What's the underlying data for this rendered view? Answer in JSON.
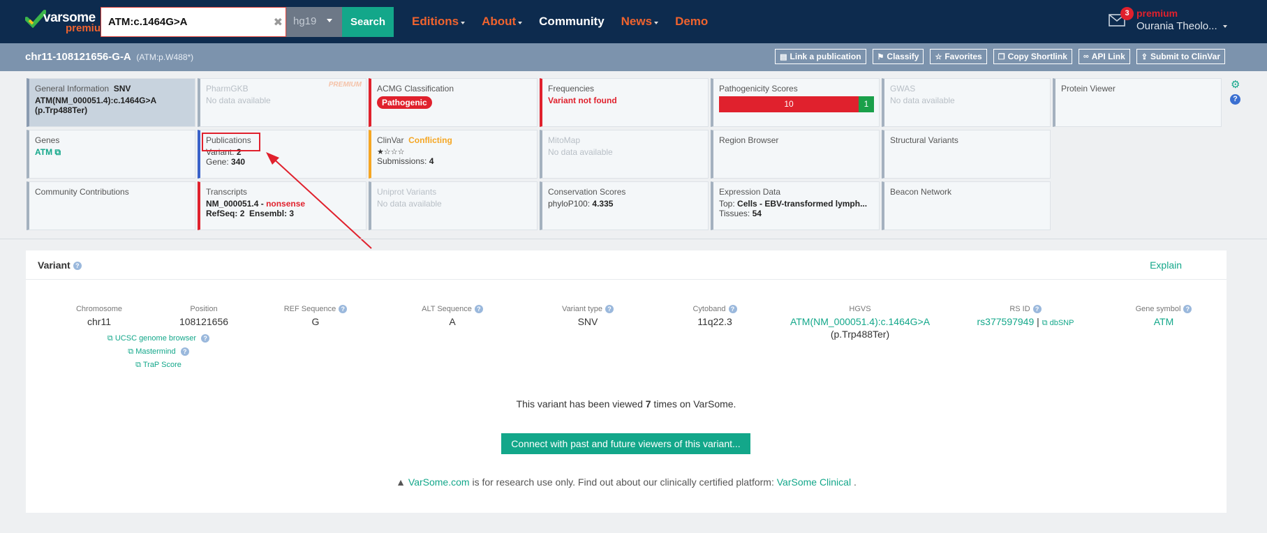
{
  "header": {
    "brand_top": "varsome",
    "brand_bottom": "premium",
    "search_value": "ATM:c.1464G>A",
    "genome": "hg19",
    "search_label": "Search",
    "nav": [
      "Editions",
      "About",
      "Community",
      "News",
      "Demo"
    ],
    "notifications": "3",
    "premium_label": "premium",
    "user_name": "Ourania Theolo..."
  },
  "subheader": {
    "variant_id": "chr11-108121656-G-A",
    "variant_protein": "(ATM:p.W488*)",
    "actions": [
      "Link a publication",
      "Classify",
      "Favorites",
      "Copy Shortlink",
      "API Link",
      "Submit to ClinVar"
    ]
  },
  "tiles": {
    "general": {
      "title": "General Information",
      "type": "SNV",
      "hgvs": "ATM(NM_000051.4):c.1464G>A",
      "protein": "(p.Trp488Ter)"
    },
    "pharmgkb": {
      "title": "PharmGKB",
      "status": "No data available",
      "badge": "PREMIUM"
    },
    "acmg": {
      "title": "ACMG Classification",
      "value": "Pathogenic"
    },
    "frequencies": {
      "title": "Frequencies",
      "value": "Variant not found"
    },
    "pathogenicity": {
      "title": "Pathogenicity Scores",
      "pathogenic": "10",
      "benign": "1"
    },
    "gwas": {
      "title": "GWAS",
      "status": "No data available"
    },
    "protein": {
      "title": "Protein Viewer"
    },
    "genes": {
      "title": "Genes",
      "gene": "ATM"
    },
    "publications": {
      "title": "Publications",
      "variant_label": "Variant:",
      "variant_count": "2",
      "gene_label": "Gene:",
      "gene_count": "340"
    },
    "clinvar": {
      "title": "ClinVar",
      "status": "Conflicting",
      "stars": "★☆☆☆",
      "submissions_label": "Submissions:",
      "submissions": "4"
    },
    "mitomap": {
      "title": "MitoMap",
      "status": "No data available"
    },
    "region": {
      "title": "Region Browser"
    },
    "structural": {
      "title": "Structural Variants"
    },
    "community": {
      "title": "Community Contributions"
    },
    "transcripts": {
      "title": "Transcripts",
      "transcript": "NM_000051.4",
      "sep": " - ",
      "effect": "nonsense",
      "refseq_label": "RefSeq:",
      "refseq": "2",
      "ensembl_label": "Ensembl:",
      "ensembl": "3"
    },
    "uniprot": {
      "title": "Uniprot Variants",
      "status": "No data available"
    },
    "conservation": {
      "title": "Conservation Scores",
      "label": "phyloP100:",
      "value": "4.335"
    },
    "expression": {
      "title": "Expression Data",
      "top_label": "Top:",
      "top_value": "Cells - EBV-transformed lymph...",
      "tissues_label": "Tissues:",
      "tissues": "54"
    },
    "beacon": {
      "title": "Beacon Network"
    }
  },
  "variant_panel": {
    "title": "Variant",
    "explain": "Explain",
    "columns": [
      {
        "label": "Chromosome",
        "value": "chr11"
      },
      {
        "label": "Position",
        "value": "108121656"
      },
      {
        "label": "REF Sequence",
        "value": "G"
      },
      {
        "label": "ALT Sequence",
        "value": "A"
      },
      {
        "label": "Variant type",
        "value": "SNV"
      },
      {
        "label": "Cytoband",
        "value": "11q22.3"
      },
      {
        "label": "HGVS",
        "value": "ATM(NM_000051.4):c.1464G>A",
        "extra": "(p.Trp488Ter)"
      },
      {
        "label": "RS ID",
        "value": "rs377597949",
        "sep": " | ",
        "extra": "dbSNP"
      },
      {
        "label": "Gene symbol",
        "value": "ATM"
      }
    ],
    "links": [
      "UCSC genome browser",
      "Mastermind",
      "TraP Score"
    ],
    "viewed_prefix": "This variant has been viewed ",
    "viewed_count": "7",
    "viewed_suffix": " times on VarSome.",
    "connect_label": "Connect with past and future viewers of this variant...",
    "research_link": "VarSome.com",
    "research_text": " is for research use only. Find out about our clinically certified platform: ",
    "clinical_link": "VarSome Clinical",
    "research_end": " ."
  },
  "colors": {
    "navy": "#0d2b4e",
    "accent": "#13a78a",
    "orange": "#f0632e",
    "red": "#e0212d"
  }
}
